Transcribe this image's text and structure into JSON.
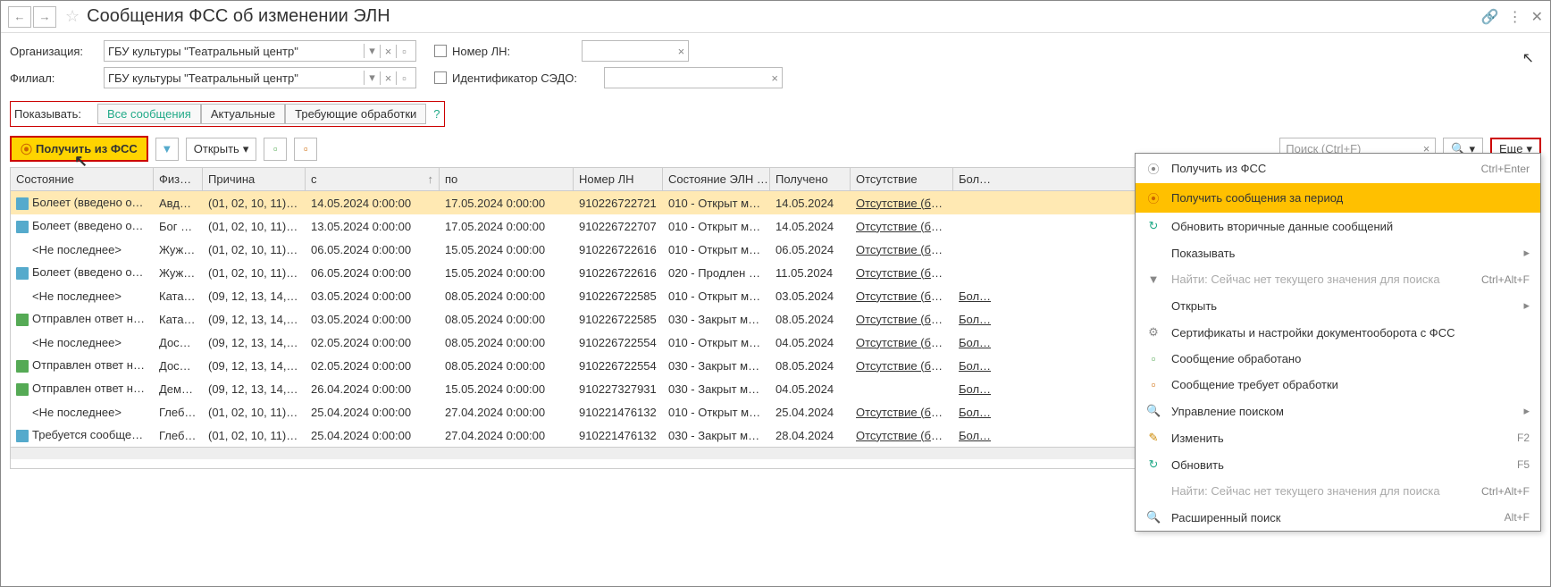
{
  "title": "Сообщения ФСС об изменении ЭЛН",
  "filters": {
    "org_label": "Организация:",
    "org_value": "ГБУ культуры \"Театральный центр\"",
    "branch_label": "Филиал:",
    "branch_value": "ГБУ культуры \"Театральный центр\"",
    "num_ln_label": "Номер ЛН:",
    "sedo_label": "Идентификатор СЭДО:"
  },
  "show": {
    "label": "Показывать:",
    "tab_all": "Все сообщения",
    "tab_actual": "Актуальные",
    "tab_need": "Требующие обработки"
  },
  "toolbar": {
    "get_fss": "Получить из ФСС",
    "open": "Открыть",
    "search_ph": "Поиск (Ctrl+F)",
    "more": "Еще"
  },
  "columns": {
    "c0": "Состояние",
    "c1": "Физ…",
    "c2": "Причина",
    "c3": "с",
    "c4": "по",
    "c5": "Номер ЛН",
    "c6": "Состояние ЭЛН …",
    "c7": "Получено",
    "c8": "Отсутствие",
    "c9": "Бол…"
  },
  "rows": [
    {
      "icon": "blue",
      "state": "Болеет (введено отс…",
      "fiz": "Авд…",
      "reason": "(01, 02, 10, 11) З…",
      "from": "14.05.2024 0:00:00",
      "to": "17.05.2024 0:00:00",
      "num": "910226722721",
      "eln": "010 - Открыт ме…",
      "recv": "14.05.2024",
      "abs": "Отсутствие (бол…",
      "bol": ""
    },
    {
      "icon": "blue",
      "state": "Болеет (введено отс…",
      "fiz": "Бог д…",
      "reason": "(01, 02, 10, 11) З…",
      "from": "13.05.2024 0:00:00",
      "to": "17.05.2024 0:00:00",
      "num": "910226722707",
      "eln": "010 - Открыт ме…",
      "recv": "14.05.2024",
      "abs": "Отсутствие (бол…",
      "bol": ""
    },
    {
      "icon": "",
      "state": "<Не последнее>",
      "fiz": "Жуж…",
      "reason": "(01, 02, 10, 11) З…",
      "from": "06.05.2024 0:00:00",
      "to": "15.05.2024 0:00:00",
      "num": "910226722616",
      "eln": "010 - Открыт ме…",
      "recv": "06.05.2024",
      "abs": "Отсутствие (бол…",
      "bol": ""
    },
    {
      "icon": "blue",
      "state": "Болеет (введено отс…",
      "fiz": "Жуж…",
      "reason": "(01, 02, 10, 11) З…",
      "from": "06.05.2024 0:00:00",
      "to": "15.05.2024 0:00:00",
      "num": "910226722616",
      "eln": "020 - Продлен м…",
      "recv": "11.05.2024",
      "abs": "Отсутствие (бол…",
      "bol": ""
    },
    {
      "icon": "",
      "state": "<Не последнее>",
      "fiz": "Ката…",
      "reason": "(09, 12, 13, 14, 1…",
      "from": "03.05.2024 0:00:00",
      "to": "08.05.2024 0:00:00",
      "num": "910226722585",
      "eln": "010 - Открыт ме…",
      "recv": "03.05.2024",
      "abs": "Отсутствие (бол…",
      "bol": "Бол…"
    },
    {
      "icon": "green",
      "state": "Отправлен ответ на …",
      "fiz": "Ката…",
      "reason": "(09, 12, 13, 14, 1…",
      "from": "03.05.2024 0:00:00",
      "to": "08.05.2024 0:00:00",
      "num": "910226722585",
      "eln": "030 - Закрыт ме…",
      "recv": "08.05.2024",
      "abs": "Отсутствие (бол…",
      "bol": "Бол…"
    },
    {
      "icon": "",
      "state": "<Не последнее>",
      "fiz": "Дос…",
      "reason": "(09, 12, 13, 14, 1…",
      "from": "02.05.2024 0:00:00",
      "to": "08.05.2024 0:00:00",
      "num": "910226722554",
      "eln": "010 - Открыт ме…",
      "recv": "04.05.2024",
      "abs": "Отсутствие (бол…",
      "bol": "Бол…"
    },
    {
      "icon": "green",
      "state": "Отправлен ответ на …",
      "fiz": "Дос…",
      "reason": "(09, 12, 13, 14, 1…",
      "from": "02.05.2024 0:00:00",
      "to": "08.05.2024 0:00:00",
      "num": "910226722554",
      "eln": "030 - Закрыт ме…",
      "recv": "08.05.2024",
      "abs": "Отсутствие (бол…",
      "bol": "Бол…"
    },
    {
      "icon": "green",
      "state": "Отправлен ответ на …",
      "fiz": "Дем…",
      "reason": "(09, 12, 13, 14, 1…",
      "from": "26.04.2024 0:00:00",
      "to": "15.05.2024 0:00:00",
      "num": "910227327931",
      "eln": "030 - Закрыт ме…",
      "recv": "04.05.2024",
      "abs": "",
      "bol": "Бол…"
    },
    {
      "icon": "",
      "state": "<Не последнее>",
      "fiz": "Глеб…",
      "reason": "(01, 02, 10, 11) З…",
      "from": "25.04.2024 0:00:00",
      "to": "27.04.2024 0:00:00",
      "num": "910221476132",
      "eln": "010 - Открыт ме…",
      "recv": "25.04.2024",
      "abs": "Отсутствие (бол…",
      "bol": "Бол…"
    },
    {
      "icon": "blue",
      "state": "Требуется сообщен…",
      "fiz": "Глеб…",
      "reason": "(01, 02, 10, 11) З…",
      "from": "25.04.2024 0:00:00",
      "to": "27.04.2024 0:00:00",
      "num": "910221476132",
      "eln": "030 - Закрыт ме…",
      "recv": "28.04.2024",
      "abs": "Отсутствие (бол…",
      "bol": "Бол…"
    }
  ],
  "menu": {
    "get_fss": "Получить из ФСС",
    "get_fss_sc": "Ctrl+Enter",
    "get_period": "Получить сообщения за период",
    "update_sec": "Обновить вторичные данные сообщений",
    "show": "Показывать",
    "find_disabled": "Найти: Сейчас нет текущего значения для поиска",
    "find_sc": "Ctrl+Alt+F",
    "open": "Открыть",
    "certs": "Сертификаты и настройки документооборота с ФСС",
    "processed": "Сообщение обработано",
    "needs": "Сообщение требует обработки",
    "search_mgmt": "Управление поиском",
    "edit": "Изменить",
    "edit_sc": "F2",
    "refresh": "Обновить",
    "refresh_sc": "F5",
    "find_disabled2": "Найти: Сейчас нет текущего значения для поиска",
    "find_sc2": "Ctrl+Alt+F",
    "adv_search": "Расширенный поиск",
    "adv_sc": "Alt+F"
  }
}
